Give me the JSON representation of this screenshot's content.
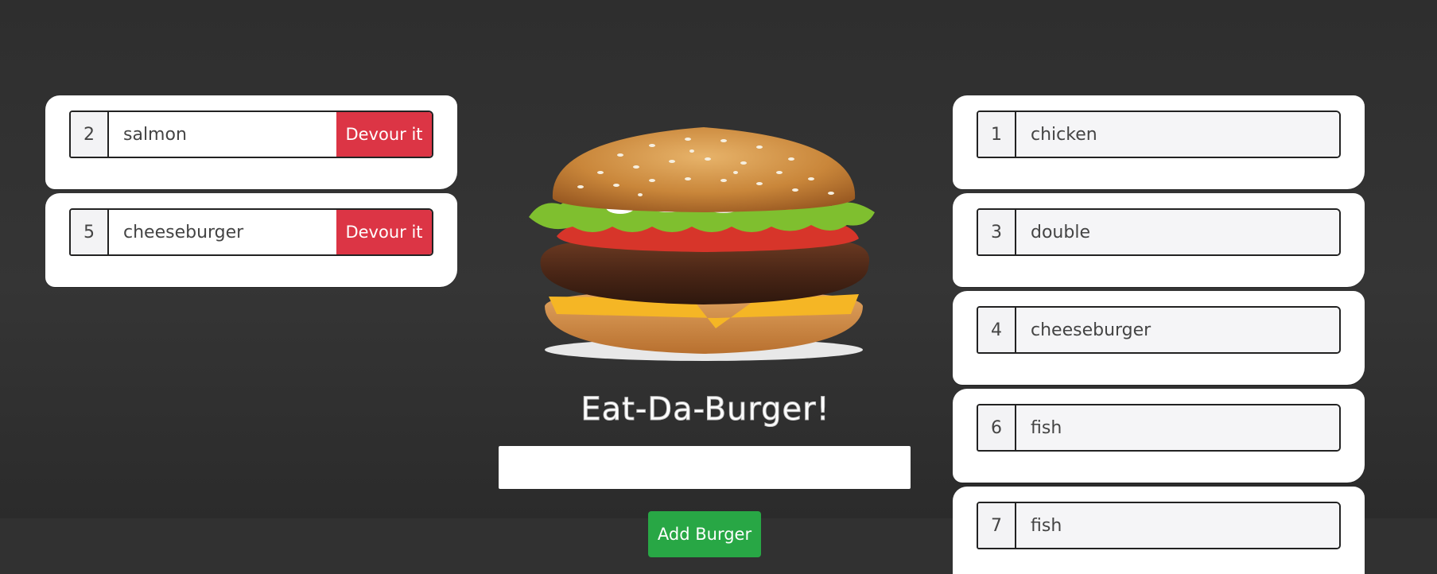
{
  "title": "Eat-Da-Burger!",
  "input": {
    "value": "",
    "placeholder": ""
  },
  "add_button": "Add Burger",
  "devour_label": "Devour it",
  "uneaten": [
    {
      "id": "2",
      "name": "salmon"
    },
    {
      "id": "5",
      "name": "cheeseburger"
    }
  ],
  "devoured": [
    {
      "id": "1",
      "name": "chicken"
    },
    {
      "id": "3",
      "name": "double"
    },
    {
      "id": "4",
      "name": "cheeseburger"
    },
    {
      "id": "6",
      "name": "fish"
    },
    {
      "id": "7",
      "name": "fish"
    }
  ],
  "colors": {
    "background": "#303030",
    "devour": "#dc3545",
    "add": "#28a745"
  }
}
